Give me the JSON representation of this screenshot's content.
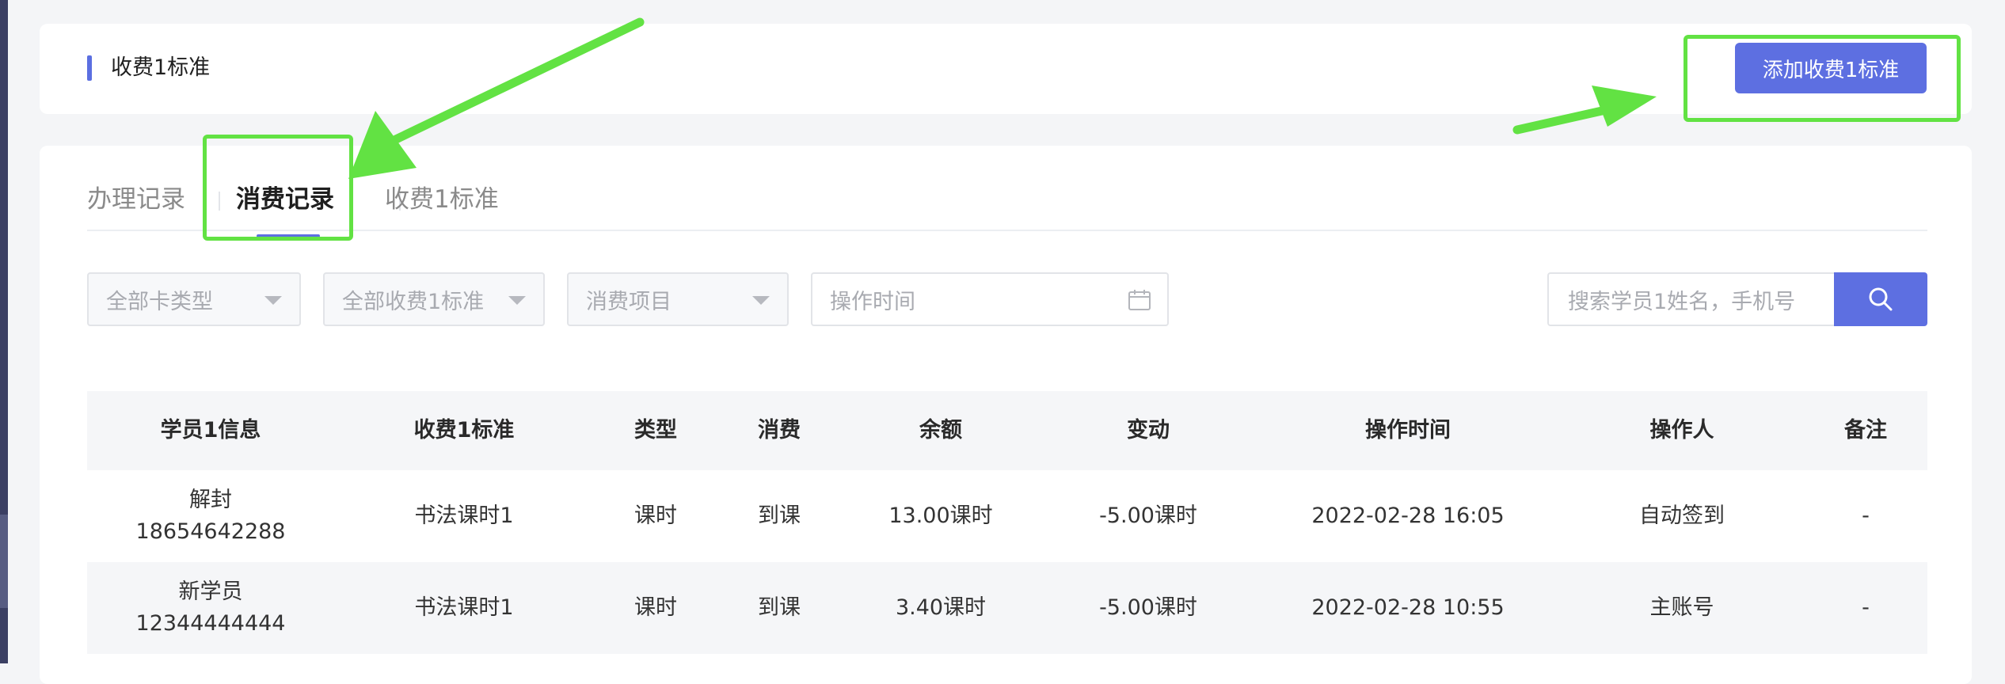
{
  "header": {
    "title": "收费1标准",
    "add_button_label": "添加收费1标准"
  },
  "tabs": [
    {
      "label": "办理记录",
      "active": false
    },
    {
      "label": "消费记录",
      "active": true
    },
    {
      "label": "收费1标准",
      "active": false
    }
  ],
  "filters": {
    "card_type": "全部卡类型",
    "charge_standard": "全部收费1标准",
    "consume_item": "消费项目",
    "time_placeholder": "操作时间",
    "search_placeholder": "搜索学员1姓名，手机号"
  },
  "table": {
    "columns": [
      "学员1信息",
      "收费1标准",
      "类型",
      "消费",
      "余额",
      "变动",
      "操作时间",
      "操作人",
      "备注"
    ],
    "rows": [
      {
        "name": "解封",
        "phone": "18654642288",
        "standard": "书法课时1",
        "type": "课时",
        "consume": "到课",
        "balance": "13.00课时",
        "change": "-5.00课时",
        "time": "2022-02-28 16:05",
        "operator": "自动签到",
        "note": "-"
      },
      {
        "name": "新学员",
        "phone": "12344444444",
        "standard": "书法课时1",
        "type": "课时",
        "consume": "到课",
        "balance": "3.40课时",
        "change": "-5.00课时",
        "time": "2022-02-28 10:55",
        "operator": "主账号",
        "note": "-"
      }
    ]
  },
  "colors": {
    "accent": "#5d6fe1",
    "annotation": "#62e243"
  }
}
